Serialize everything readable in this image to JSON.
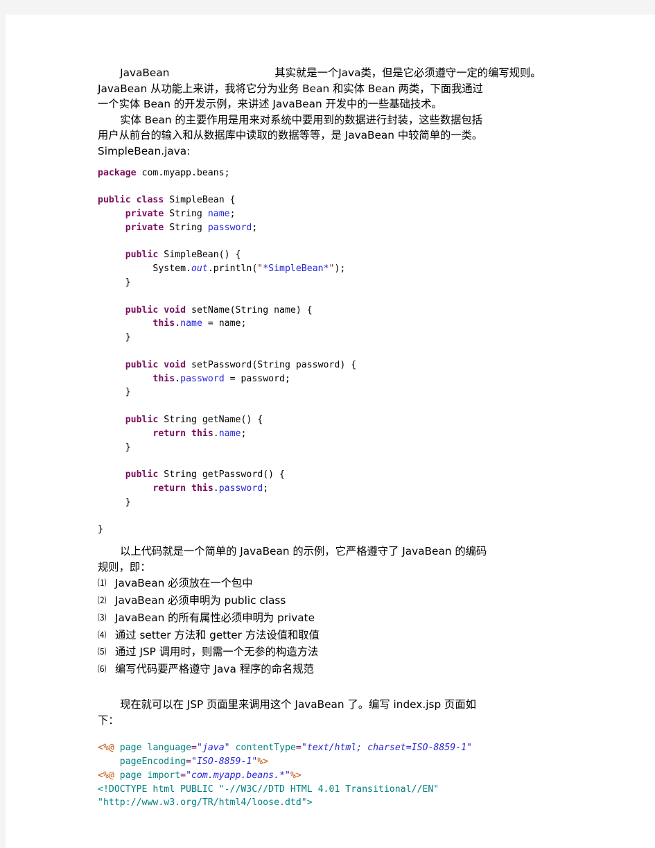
{
  "document": {
    "title": "JavaBean",
    "intro": {
      "lead_term": "JavaBean",
      "lead_rest": "其实就是一个Java类，但是它必须遵守一定的编写规则。",
      "para1_line2": "JavaBean 从功能上来讲，我将它分为业务 Bean 和实体 Bean 两类，下面我通过",
      "para1_line3": "一个实体 Bean 的开发示例，来讲述 JavaBean 开发中的一些基础技术。",
      "para2_line1": "实体 Bean 的主要作用是用来对系统中要用到的数据进行封装，这些数据包括",
      "para2_line2": "用户从前台的输入和从数据库中读取的数据等等，是 JavaBean 中较简单的一类。",
      "filename_label": "SimpleBean.java:"
    },
    "java_code": {
      "language": "java",
      "lines": [
        {
          "tokens": [
            {
              "t": "package",
              "c": "kw"
            },
            {
              "t": " com.myapp.beans;",
              "c": "plain"
            }
          ]
        },
        {
          "tokens": []
        },
        {
          "tokens": [
            {
              "t": "public",
              "c": "kw"
            },
            {
              "t": " ",
              "c": "plain"
            },
            {
              "t": "class",
              "c": "kw"
            },
            {
              "t": " SimpleBean {",
              "c": "plain"
            }
          ]
        },
        {
          "tokens": [
            {
              "t": "     ",
              "c": "plain"
            },
            {
              "t": "private",
              "c": "kw"
            },
            {
              "t": " String ",
              "c": "plain"
            },
            {
              "t": "name",
              "c": "fld"
            },
            {
              "t": ";",
              "c": "plain"
            }
          ]
        },
        {
          "tokens": [
            {
              "t": "     ",
              "c": "plain"
            },
            {
              "t": "private",
              "c": "kw"
            },
            {
              "t": " String ",
              "c": "plain"
            },
            {
              "t": "password",
              "c": "fld"
            },
            {
              "t": ";",
              "c": "plain"
            }
          ]
        },
        {
          "tokens": []
        },
        {
          "tokens": [
            {
              "t": "     ",
              "c": "plain"
            },
            {
              "t": "public",
              "c": "kw"
            },
            {
              "t": " SimpleBean() {",
              "c": "plain"
            }
          ]
        },
        {
          "tokens": [
            {
              "t": "          System.",
              "c": "plain"
            },
            {
              "t": "out",
              "c": "fldi"
            },
            {
              "t": ".println(",
              "c": "plain"
            },
            {
              "t": "\"",
              "c": "q"
            },
            {
              "t": "*SimpleBean*",
              "c": "str"
            },
            {
              "t": "\"",
              "c": "q"
            },
            {
              "t": ");",
              "c": "plain"
            }
          ]
        },
        {
          "tokens": [
            {
              "t": "     }",
              "c": "plain"
            }
          ]
        },
        {
          "tokens": []
        },
        {
          "tokens": [
            {
              "t": "     ",
              "c": "plain"
            },
            {
              "t": "public",
              "c": "kw"
            },
            {
              "t": " ",
              "c": "plain"
            },
            {
              "t": "void",
              "c": "kw"
            },
            {
              "t": " setName(String name) {",
              "c": "plain"
            }
          ]
        },
        {
          "tokens": [
            {
              "t": "          ",
              "c": "plain"
            },
            {
              "t": "this",
              "c": "kw"
            },
            {
              "t": ".",
              "c": "plain"
            },
            {
              "t": "name",
              "c": "fld"
            },
            {
              "t": " = name;",
              "c": "plain"
            }
          ]
        },
        {
          "tokens": [
            {
              "t": "     }",
              "c": "plain"
            }
          ]
        },
        {
          "tokens": []
        },
        {
          "tokens": [
            {
              "t": "     ",
              "c": "plain"
            },
            {
              "t": "public",
              "c": "kw"
            },
            {
              "t": " ",
              "c": "plain"
            },
            {
              "t": "void",
              "c": "kw"
            },
            {
              "t": " setPassword(String password) {",
              "c": "plain"
            }
          ]
        },
        {
          "tokens": [
            {
              "t": "          ",
              "c": "plain"
            },
            {
              "t": "this",
              "c": "kw"
            },
            {
              "t": ".",
              "c": "plain"
            },
            {
              "t": "password",
              "c": "fld"
            },
            {
              "t": " = password;",
              "c": "plain"
            }
          ]
        },
        {
          "tokens": [
            {
              "t": "     }",
              "c": "plain"
            }
          ]
        },
        {
          "tokens": []
        },
        {
          "tokens": [
            {
              "t": "     ",
              "c": "plain"
            },
            {
              "t": "public",
              "c": "kw"
            },
            {
              "t": " String getName() {",
              "c": "plain"
            }
          ]
        },
        {
          "tokens": [
            {
              "t": "          ",
              "c": "plain"
            },
            {
              "t": "return",
              "c": "kw"
            },
            {
              "t": " ",
              "c": "plain"
            },
            {
              "t": "this",
              "c": "kw"
            },
            {
              "t": ".",
              "c": "plain"
            },
            {
              "t": "name",
              "c": "fld"
            },
            {
              "t": ";",
              "c": "plain"
            }
          ]
        },
        {
          "tokens": [
            {
              "t": "     }",
              "c": "plain"
            }
          ]
        },
        {
          "tokens": []
        },
        {
          "tokens": [
            {
              "t": "     ",
              "c": "plain"
            },
            {
              "t": "public",
              "c": "kw"
            },
            {
              "t": " String getPassword() {",
              "c": "plain"
            }
          ]
        },
        {
          "tokens": [
            {
              "t": "          ",
              "c": "plain"
            },
            {
              "t": "return",
              "c": "kw"
            },
            {
              "t": " ",
              "c": "plain"
            },
            {
              "t": "this",
              "c": "kw"
            },
            {
              "t": ".",
              "c": "plain"
            },
            {
              "t": "password",
              "c": "fld"
            },
            {
              "t": ";",
              "c": "plain"
            }
          ]
        },
        {
          "tokens": [
            {
              "t": "     }",
              "c": "plain"
            }
          ]
        },
        {
          "tokens": []
        },
        {
          "tokens": [
            {
              "t": "}",
              "c": "plain"
            }
          ]
        }
      ]
    },
    "rules_intro": {
      "line1": "以上代码就是一个简单的 JavaBean 的示例，它严格遵守了 JavaBean 的编码",
      "line2": "规则，即："
    },
    "rules": [
      {
        "marker": "⑴",
        "text": "JavaBean 必须放在一个包中"
      },
      {
        "marker": "⑵",
        "text": "JavaBean 必须申明为 public class"
      },
      {
        "marker": "⑶",
        "text": "JavaBean 的所有属性必须申明为 private"
      },
      {
        "marker": "⑷",
        "text": "通过 setter 方法和 getter 方法设值和取值"
      },
      {
        "marker": "⑸",
        "text": "通过 JSP 调用时，则需一个无参的构造方法"
      },
      {
        "marker": "⑹",
        "text": "编写代码要严格遵守 Java 程序的命名规范"
      }
    ],
    "jsp_intro": {
      "line1": "现在就可以在 JSP 页面里来调用这个 JavaBean 了。编写 index.jsp 页面如",
      "line2": "下："
    },
    "jsp_code": {
      "filename": "index.jsp",
      "lines": [
        {
          "tokens": [
            {
              "t": "<%@",
              "c": "dir"
            },
            {
              "t": " ",
              "c": "attr"
            },
            {
              "t": "page",
              "c": "attr"
            },
            {
              "t": " ",
              "c": "attr"
            },
            {
              "t": "language",
              "c": "attr"
            },
            {
              "t": "=",
              "c": "eq"
            },
            {
              "t": "\"java\"",
              "c": "val"
            },
            {
              "t": " ",
              "c": "attr"
            },
            {
              "t": "contentType",
              "c": "attr"
            },
            {
              "t": "=",
              "c": "eq"
            },
            {
              "t": "\"text/html; charset=ISO-8859-1\"",
              "c": "val"
            }
          ]
        },
        {
          "tokens": [
            {
              "t": "    ",
              "c": "attr"
            },
            {
              "t": "pageEncoding",
              "c": "attr"
            },
            {
              "t": "=",
              "c": "eq"
            },
            {
              "t": "\"ISO-8859-1\"",
              "c": "val"
            },
            {
              "t": "%>",
              "c": "dir"
            }
          ]
        },
        {
          "tokens": [
            {
              "t": "<%@",
              "c": "dir"
            },
            {
              "t": " ",
              "c": "attr"
            },
            {
              "t": "page",
              "c": "attr"
            },
            {
              "t": " ",
              "c": "attr"
            },
            {
              "t": "import",
              "c": "attr"
            },
            {
              "t": "=",
              "c": "eq"
            },
            {
              "t": "\"com.myapp.beans.*\"",
              "c": "val"
            },
            {
              "t": "%>",
              "c": "dir"
            }
          ]
        },
        {
          "tokens": [
            {
              "t": "<!DOCTYPE html PUBLIC \"-//W3C//DTD HTML 4.01 Transitional//EN\"",
              "c": "dtd"
            }
          ]
        },
        {
          "tokens": [
            {
              "t": "\"http://www.w3.org/TR/html4/loose.dtd\">",
              "c": "dtd"
            }
          ]
        }
      ]
    }
  },
  "colors": {
    "page_background": "#f4f4f4",
    "sheet": "#ffffff",
    "text": "#000000",
    "keyword": "#7a0f5e",
    "field": "#2525d9",
    "string_quote": "#8b1a1a",
    "jsp_directive": "#c05a12",
    "jsp_attribute": "#008080",
    "jsp_value": "#2525d9"
  }
}
